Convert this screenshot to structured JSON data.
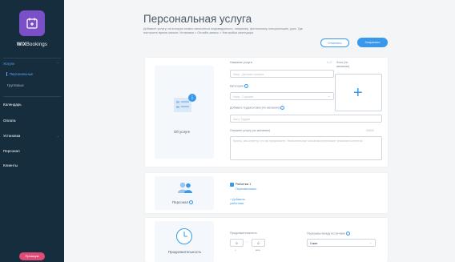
{
  "sidebar": {
    "brand_bold": "WIX",
    "brand_light": "Bookings",
    "items": [
      {
        "label": "Услуги"
      },
      {
        "label": "Календарь"
      },
      {
        "label": "Оплата"
      },
      {
        "label": "Установка"
      },
      {
        "label": "Персонал"
      },
      {
        "label": "Клиенты"
      }
    ],
    "sub_items": [
      {
        "label": "Персональные"
      },
      {
        "label": "Групповые"
      }
    ],
    "promo_button": "Премиум"
  },
  "header": {
    "title": "Персональная услуга",
    "description": "Добавьте услугу, на которую можно записаться индивидуально, например, фотосъемку, консультацию, урок. Где настроить время записи: Установка > Онлайн-запись > Настройки календаря.",
    "cancel_label": "Отменить",
    "save_label": "Сохранить"
  },
  "about": {
    "caption": "Об услуге",
    "name_label": "Название услуги",
    "name_counter": "0 / 0",
    "name_placeholder": "Напр.: Детская стрижка",
    "category_label": "Категория",
    "category_placeholder": "Напр.: Стрижки",
    "tagline_label": "Добавьте подзаголовок (по желанию)",
    "tagline_counter": "0/80",
    "tagline_placeholder": "Как у Тоудэм",
    "desc_label": "Опишите услугу (по желанию)",
    "desc_counter": "0/1000",
    "desc_placeholder": "Кратко, как клиенту, что вы предлагаете. Увлекательные описания привлекают внимание клиентов.",
    "photo_label": "Фото (по желанию)"
  },
  "staff": {
    "caption": "Персонал",
    "member_name": "Работник 1",
    "member_link": "Переименовать",
    "add_link": "+ Добавить работника"
  },
  "duration": {
    "caption": "Продолжительность",
    "duration_label": "Продолжительность",
    "hours_value": "0",
    "minutes_value": "0",
    "hours_unit": "ч",
    "minutes_unit": "мин",
    "break_label": "Перерывы между встречами",
    "break_value": "0 мин"
  },
  "colors": {
    "accent": "#3899ec",
    "sidebar": "#162d3d",
    "promo": "#e04a77",
    "logo": "#7b4fc7"
  }
}
